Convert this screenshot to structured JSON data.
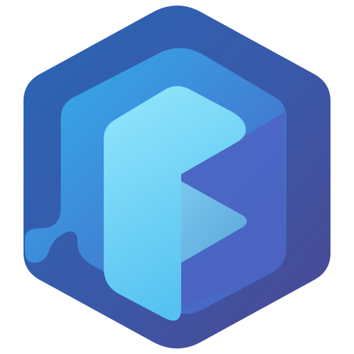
{
  "logo": {
    "icon": "hexagon-letter-p-icon",
    "colors": {
      "outer_hex_start": "#2A63B2",
      "outer_hex_end": "#4A4B95",
      "middle_layer_start": "#35ADEB",
      "middle_layer_end": "#4A5FC4",
      "front_p_start": "#8FE5FB",
      "front_p_end": "#57C5F2",
      "triangle": "#6FB8E2"
    }
  }
}
